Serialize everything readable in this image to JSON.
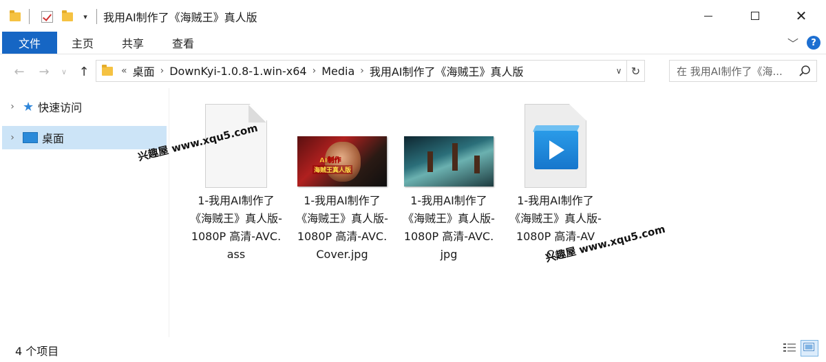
{
  "window": {
    "title": "我用AI制作了《海贼王》真人版"
  },
  "ribbon": {
    "tabs": [
      "文件",
      "主页",
      "共享",
      "查看"
    ]
  },
  "address": {
    "overflow": "«",
    "crumbs": [
      "桌面",
      "DownKyi-1.0.8-1.win-x64",
      "Media",
      "我用AI制作了《海贼王》真人版"
    ]
  },
  "search": {
    "placeholder": "在 我用AI制作了《海..."
  },
  "sidebar": {
    "items": [
      {
        "label": "快速访问",
        "icon": "star-icon",
        "selected": false
      },
      {
        "label": "桌面",
        "icon": "desktop-icon",
        "selected": true
      }
    ]
  },
  "files": [
    {
      "name": "1-我用AI制作了《海贼王》真人版-1080P 高清-AVC.ass",
      "icon": "document-icon"
    },
    {
      "name": "1-我用AI制作了《海贼王》真人版-1080P 高清-AVC.Cover.jpg",
      "icon": "image-thumbnail",
      "caption_top": "AI制作",
      "caption_bottom": "海贼王真人版"
    },
    {
      "name": "1-我用AI制作了《海贼王》真人版-1080P 高清-AVC.jpg",
      "icon": "image-thumbnail"
    },
    {
      "name": "1-我用AI制作了《海贼王》真人版-1080P 高清-AVC...",
      "icon": "video-file-icon"
    }
  ],
  "watermarks": [
    "兴趣屋 www.xqu5.com",
    "兴趣屋 www.xqu5.com"
  ],
  "status": {
    "item_count": "4 个项目"
  },
  "colors": {
    "accent": "#1666c4",
    "selection": "#cce4f7",
    "folder": "#f5c242"
  }
}
